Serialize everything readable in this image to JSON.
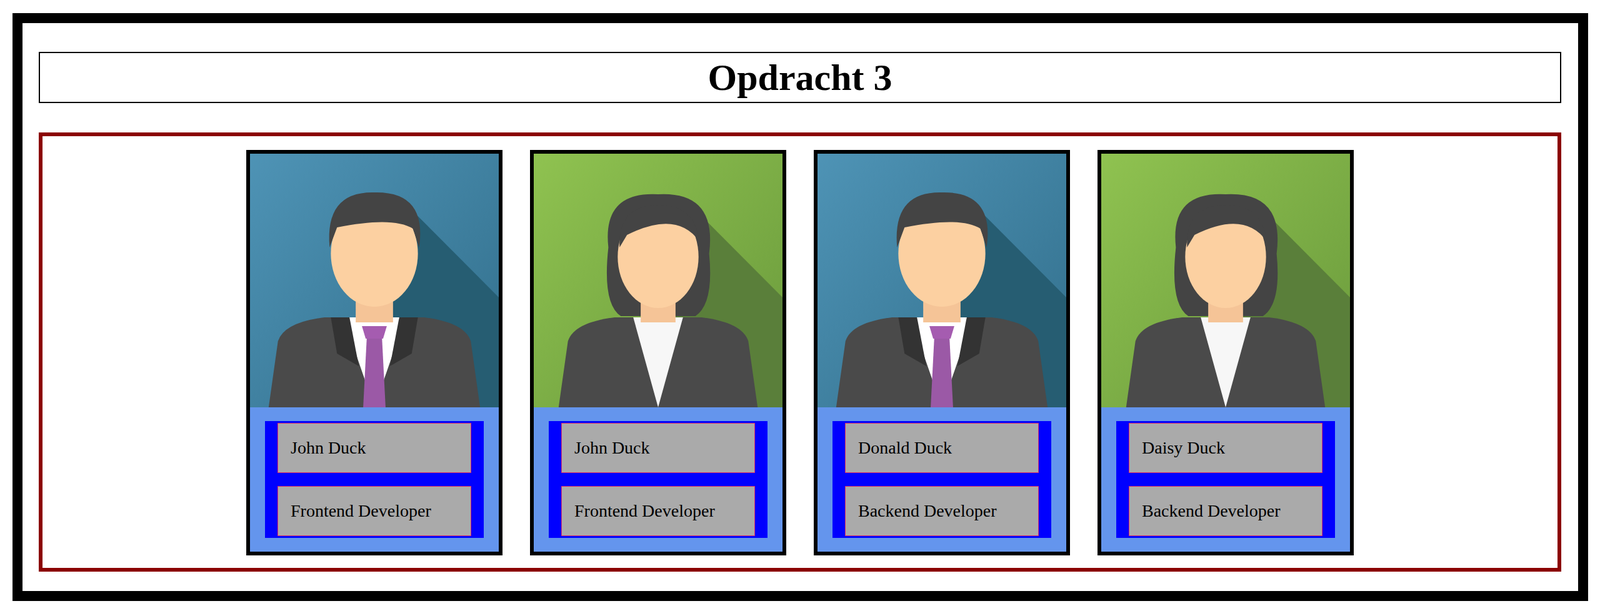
{
  "title": "Opdracht 3",
  "cards": [
    {
      "name": "John Duck",
      "role": "Frontend Developer",
      "kind": "male"
    },
    {
      "name": "John Duck",
      "role": "Frontend Developer",
      "kind": "female"
    },
    {
      "name": "Donald Duck",
      "role": "Backend Developer",
      "kind": "male"
    },
    {
      "name": "Daisy Duck",
      "role": "Backend Developer",
      "kind": "female"
    }
  ]
}
